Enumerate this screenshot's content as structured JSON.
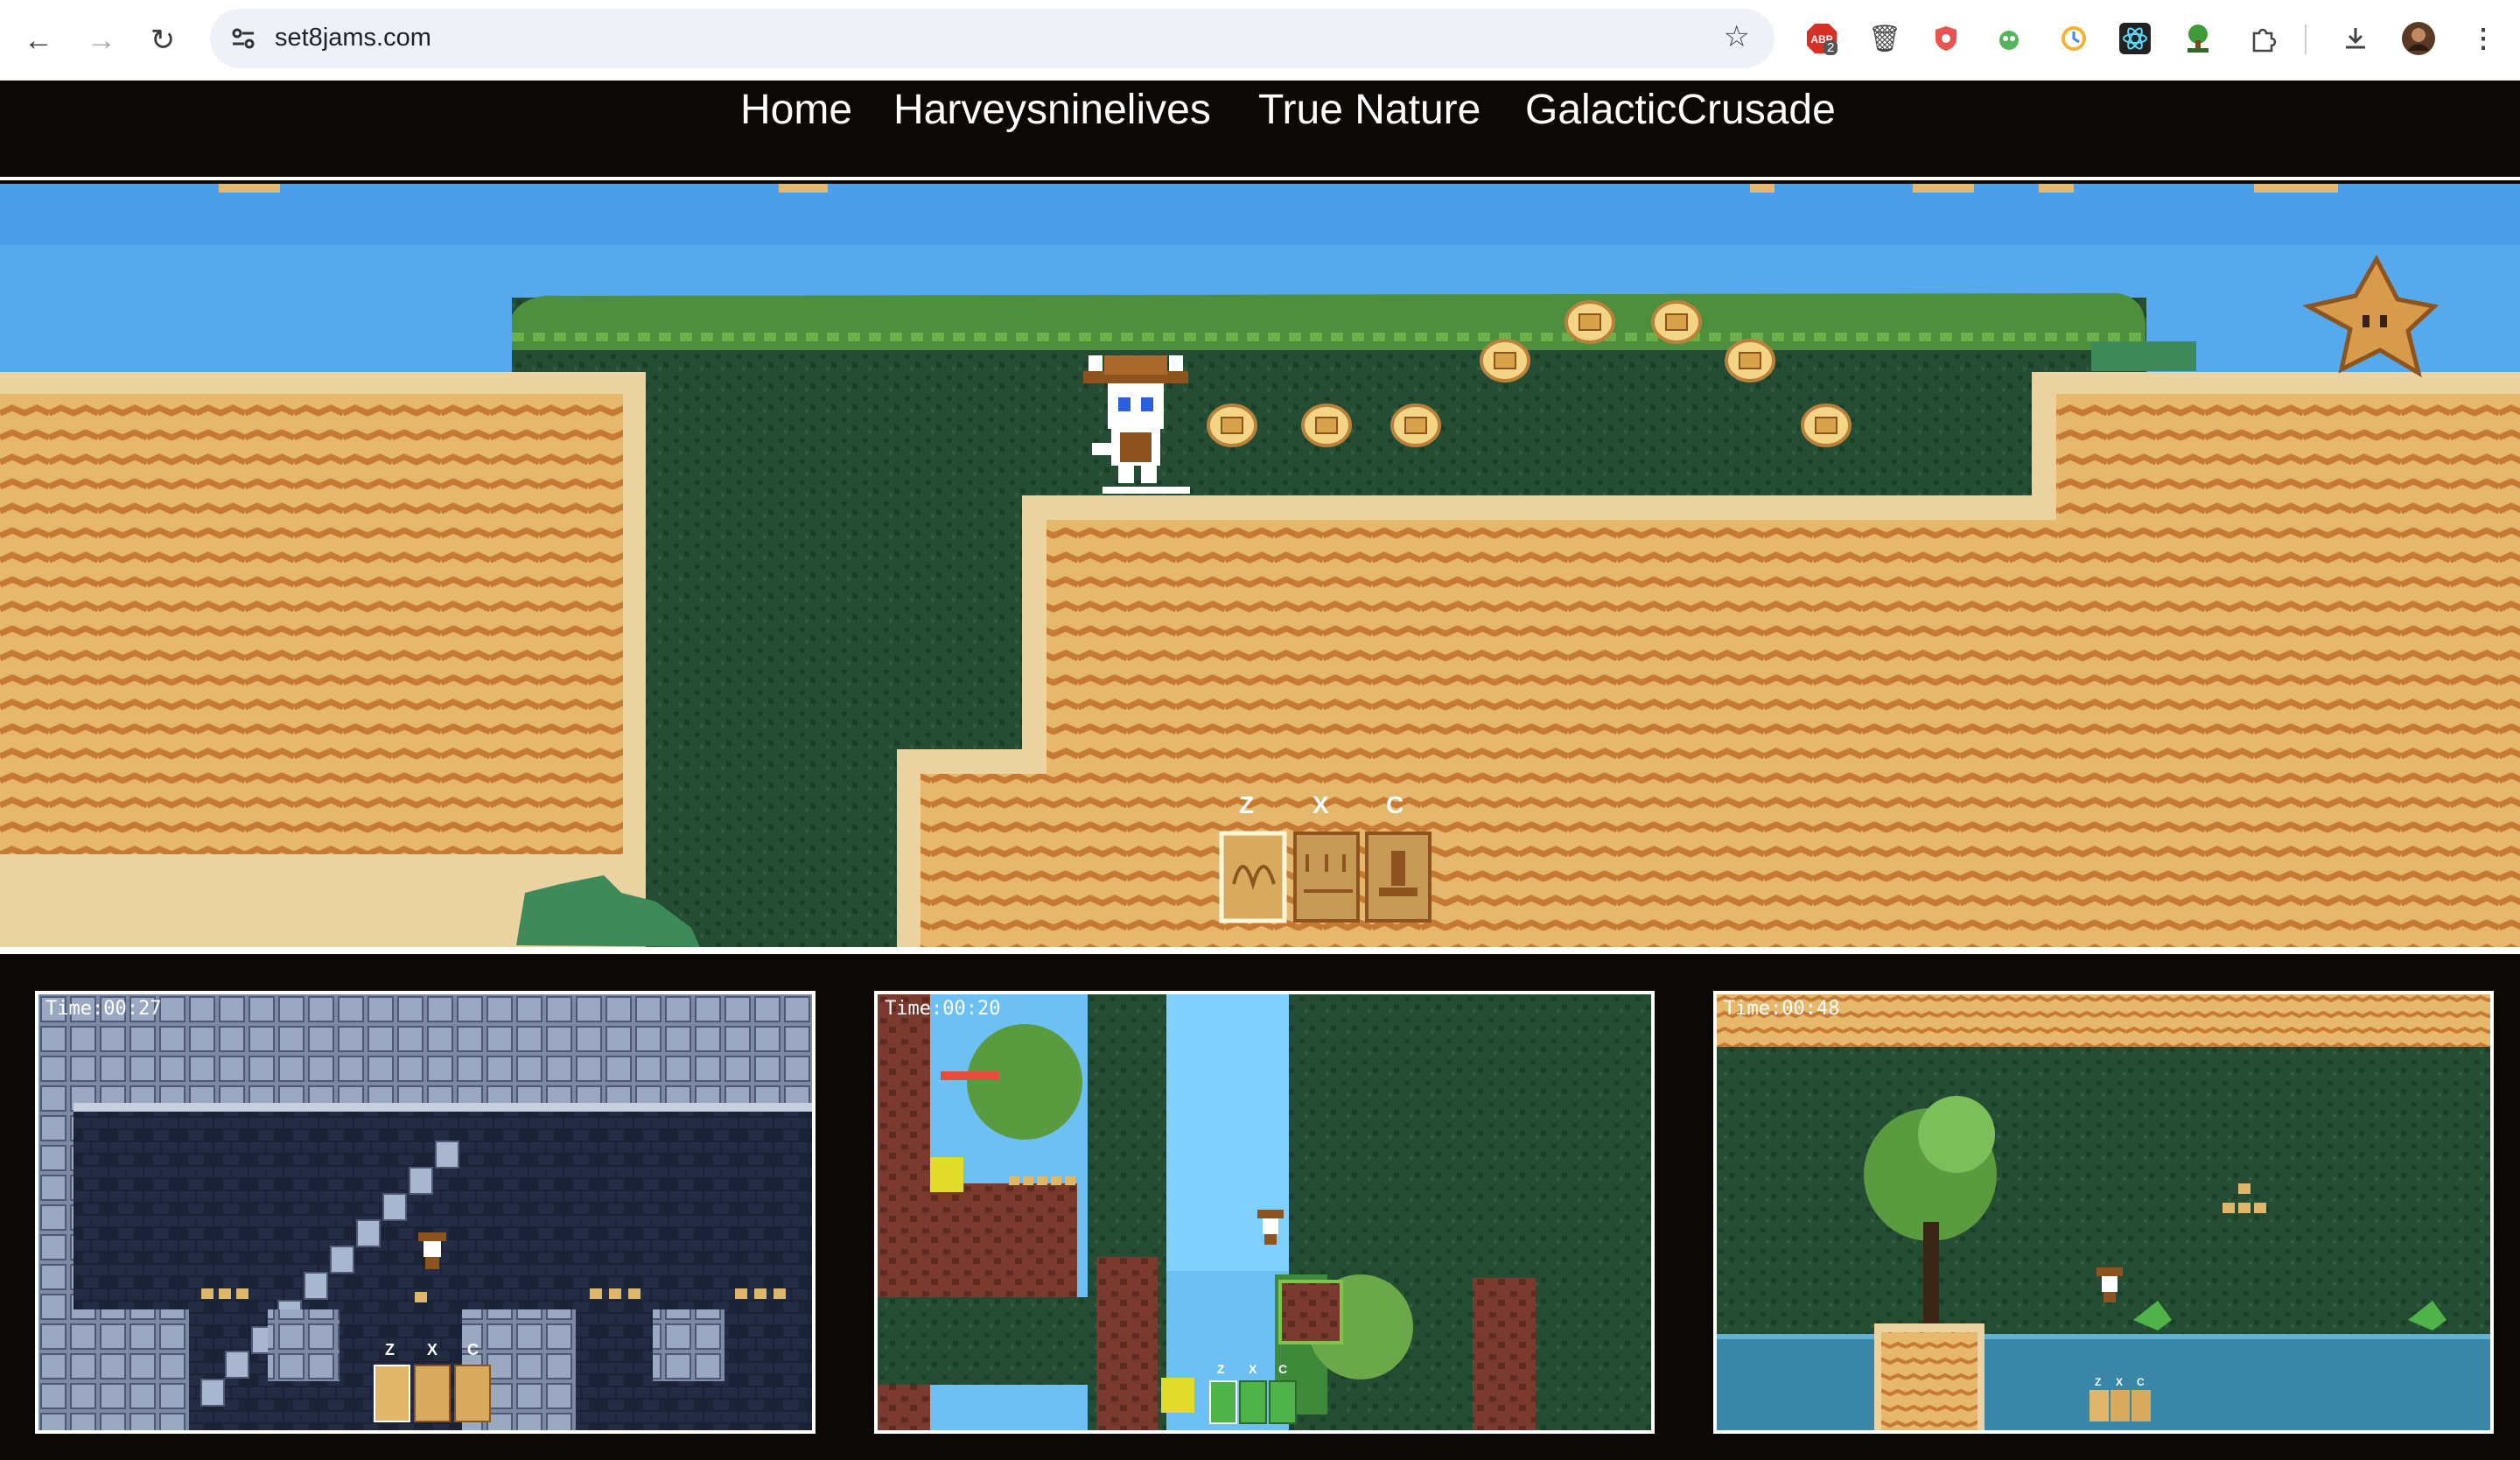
{
  "browser": {
    "url": "set8jams.com",
    "extensions": [
      "adblock-icon",
      "trash-icon",
      "shield-icon",
      "bug-icon",
      "clock-icon",
      "react-icon",
      "tree-icon",
      "puzzle-icon"
    ],
    "adblock_badge": "2"
  },
  "nav": {
    "links": [
      "Home",
      "Harveysninelives",
      "True Nature",
      "GalacticCrusade"
    ]
  },
  "hero": {
    "skills": {
      "z": "Z",
      "x": "X",
      "c": "C"
    },
    "colors": {
      "sky": "#57a9ee",
      "sand": "#e6b86e",
      "sand_edge": "#ead3a0",
      "forest": "#244d33",
      "leaf": "#4d8f3c"
    }
  },
  "screenshots": [
    {
      "timer": "Time:00:27",
      "theme": "dungeon",
      "skills": [
        "Z",
        "X",
        "C"
      ]
    },
    {
      "timer": "Time:00:20",
      "theme": "forest",
      "skills": [
        "Z",
        "X",
        "C"
      ]
    },
    {
      "timer": "Time:00:48",
      "theme": "desert",
      "skills": [
        "Z",
        "X",
        "C"
      ]
    }
  ]
}
